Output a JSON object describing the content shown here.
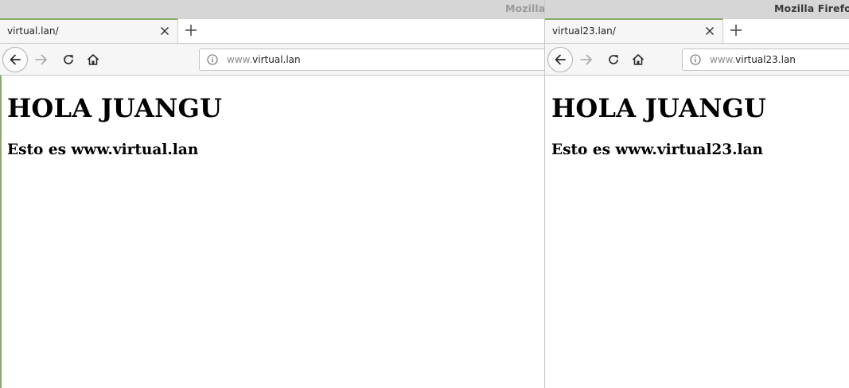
{
  "windows": [
    {
      "title": "Mozilla Firefox",
      "tab": {
        "title": "virtual.lan/"
      },
      "url": {
        "prefix": "www.",
        "domain": "virtual.lan"
      },
      "page": {
        "heading": "HOLA JUANGU",
        "subheading": "Esto es www.virtual.lan"
      }
    },
    {
      "title": "Mozilla Firefox",
      "tab": {
        "title": "virtual23.lan/"
      },
      "url": {
        "prefix": "www.",
        "domain": "virtual23.lan"
      },
      "page": {
        "heading": "HOLA JUANGU",
        "subheading": "Esto es www.virtual23.lan"
      }
    }
  ],
  "icons": [
    "close-icon",
    "plus-icon",
    "back-arrow-icon",
    "forward-arrow-icon",
    "reload-icon",
    "home-icon",
    "info-icon"
  ],
  "colors": {
    "active_tab_accent": "#86ad63",
    "titlebar": "#d6d6d6",
    "toolbar": "#f6f6f6"
  }
}
